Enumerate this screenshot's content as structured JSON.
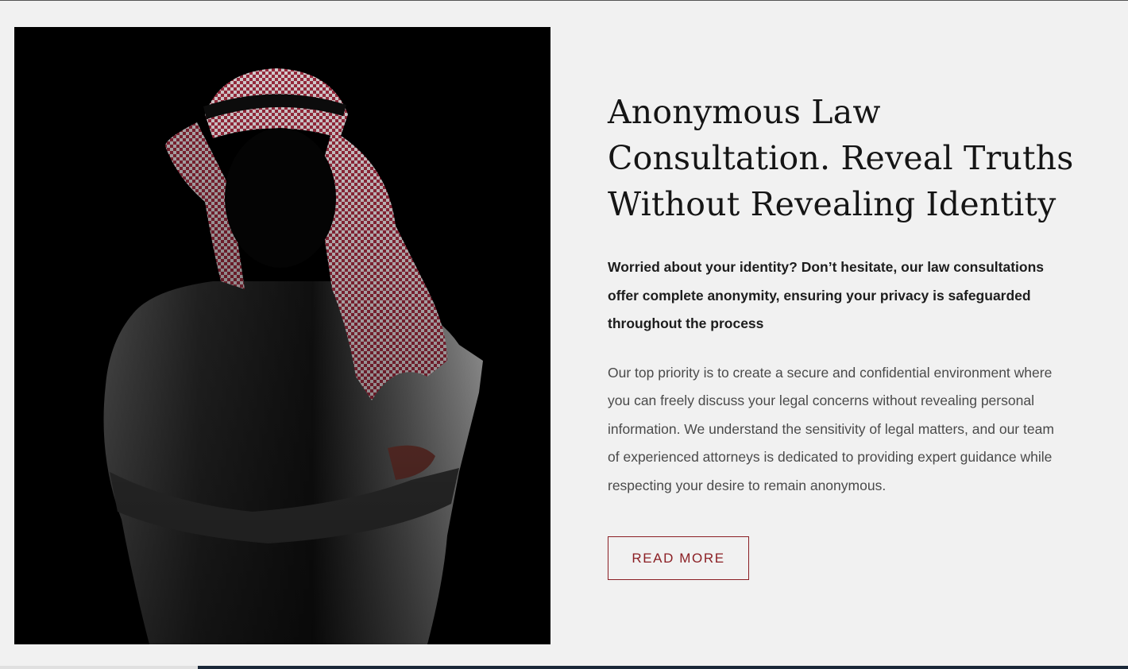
{
  "hero_image": {
    "icon": "man-in-keffiyeh-silhouette"
  },
  "section": {
    "heading_lines": [
      "Anonymous Law",
      "Consultation. Reveal Truths",
      "Without Revealing Identity"
    ],
    "lead": "Worried about your identity? Don’t hesitate, our law consultations offer complete anonymity, ensuring your privacy is safeguarded throughout the process",
    "body": "Our top priority is to create a secure and confidential environment where you can freely discuss your legal concerns without revealing personal information. We understand the sensitivity of legal matters, and our team of experienced attorneys is dedicated to providing expert guidance while respecting your desire to remain anonymous.",
    "button_label": "READ MORE"
  },
  "colors": {
    "background": "#f1f1f1",
    "accent": "#8b1f24",
    "heading": "#151515",
    "body_text": "#4a4a4a",
    "footer_dark": "#1a2838"
  }
}
